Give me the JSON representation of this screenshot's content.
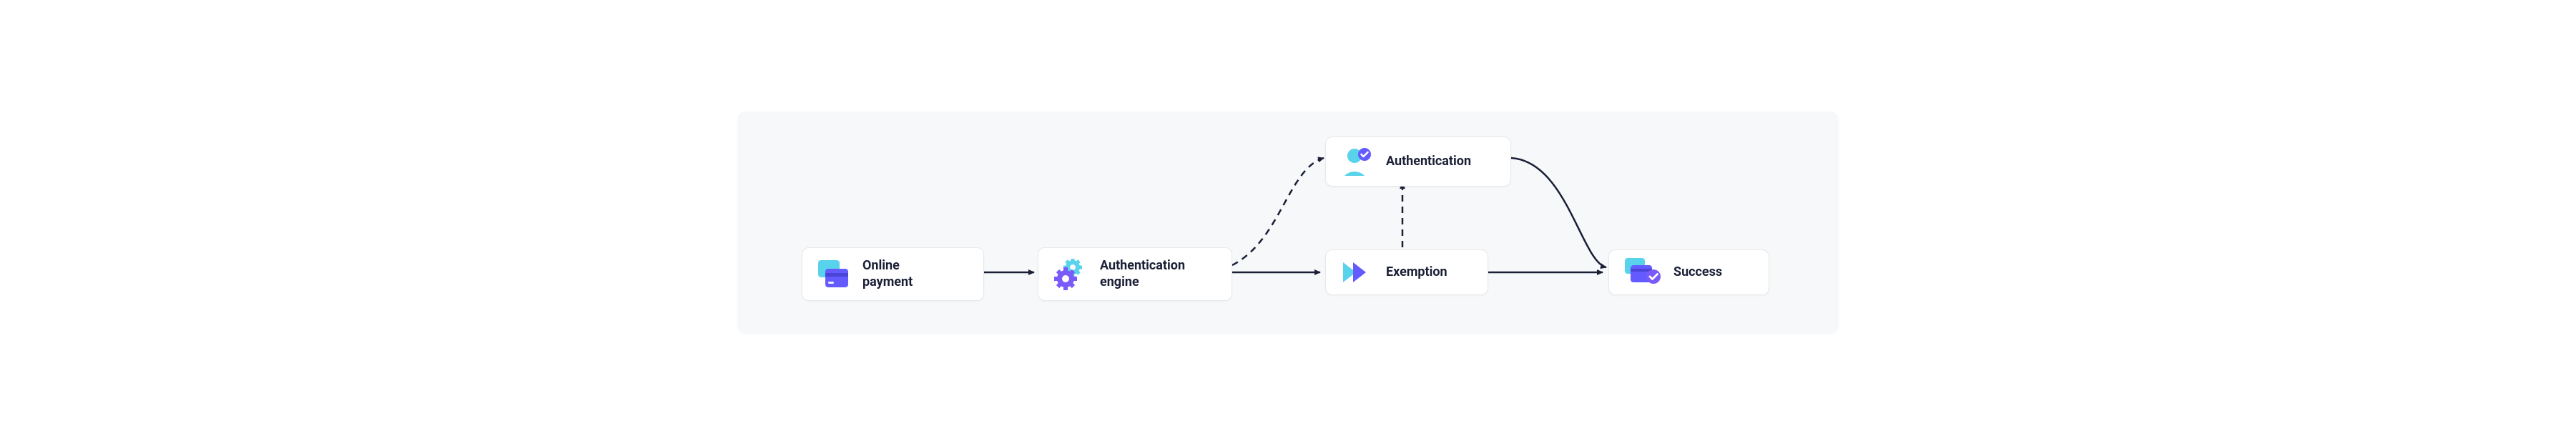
{
  "diagram": {
    "nodes": {
      "online_payment": {
        "label": "Online\npayment"
      },
      "auth_engine": {
        "label": "Authentication\nengine"
      },
      "authentication": {
        "label": "Authentication"
      },
      "exemption": {
        "label": "Exemption"
      },
      "success": {
        "label": "Success"
      }
    },
    "edges": [
      {
        "from": "online_payment",
        "to": "auth_engine",
        "style": "solid"
      },
      {
        "from": "auth_engine",
        "to": "exemption",
        "style": "solid"
      },
      {
        "from": "auth_engine",
        "to": "authentication",
        "style": "dashed"
      },
      {
        "from": "exemption",
        "to": "authentication",
        "style": "dashed"
      },
      {
        "from": "exemption",
        "to": "success",
        "style": "solid"
      },
      {
        "from": "authentication",
        "to": "success",
        "style": "solid"
      }
    ],
    "colors": {
      "cyan": "#58d3eb",
      "indigo": "#635bff",
      "purple": "#7a5af8",
      "text": "#1a1f36",
      "edge": "#1a1f36"
    }
  }
}
